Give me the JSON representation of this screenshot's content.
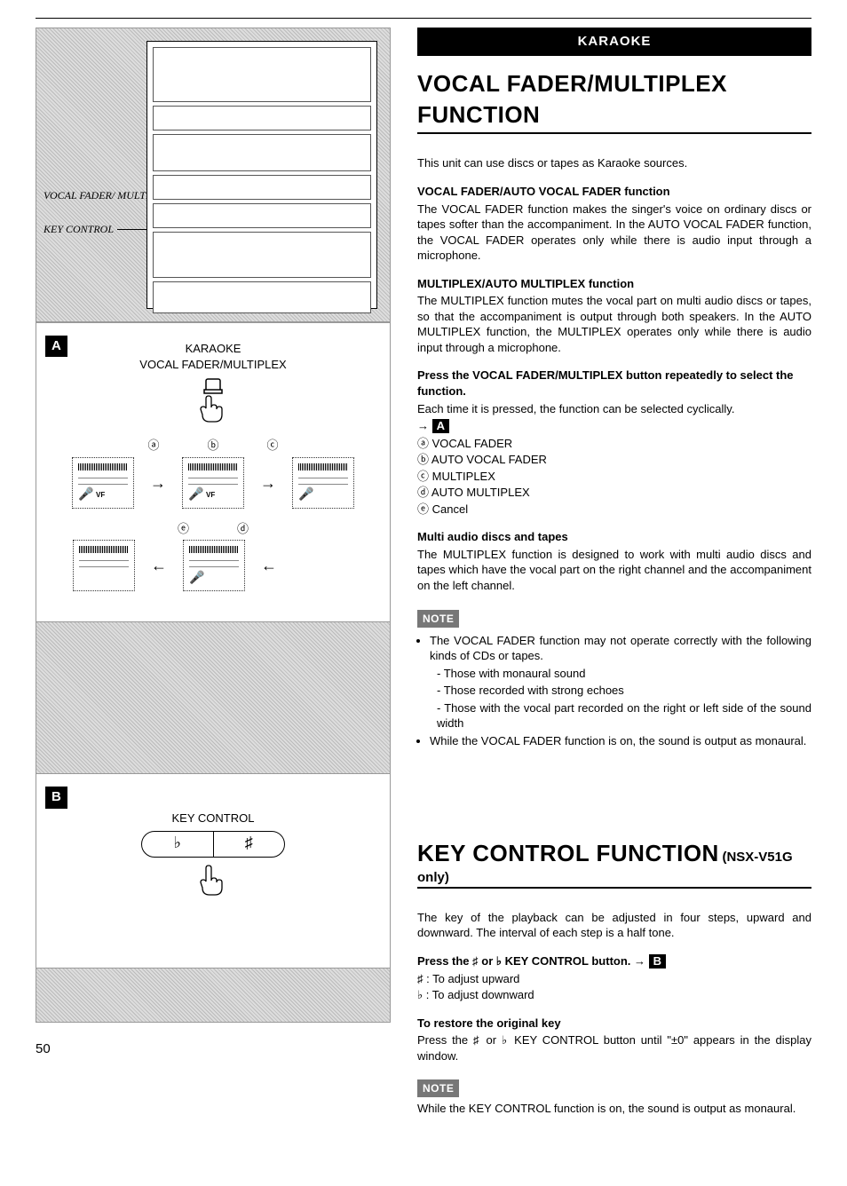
{
  "banner": "KARAOKE",
  "section1": {
    "title": "VOCAL FADER/MULTIPLEX FUNCTION",
    "intro": "This unit can use discs or tapes as Karaoke sources.",
    "sub1_h": "VOCAL FADER/AUTO VOCAL FADER function",
    "sub1_p": "The VOCAL FADER function makes the singer's voice on ordinary discs or tapes softer than the accompaniment. In the AUTO VOCAL FADER function, the VOCAL FADER operates only while there is audio input through a microphone.",
    "sub2_h": "MULTIPLEX/AUTO MULTIPLEX function",
    "sub2_p": "The MULTIPLEX function mutes the vocal part on multi audio discs or tapes, so that the accompaniment is output through both speakers. In the AUTO MULTIPLEX function, the MULTIPLEX operates only while there is audio input through a microphone.",
    "press_h": "Press the VOCAL FADER/MULTIPLEX button repeatedly to select the function.",
    "press_p": "Each time it is pressed, the function can be selected cyclically.",
    "ref_badge": "A",
    "options": {
      "a": "ⓐ VOCAL FADER",
      "b": "ⓑ AUTO VOCAL FADER",
      "c": "ⓒ MULTIPLEX",
      "d": "ⓓ AUTO MULTIPLEX",
      "e": "ⓔ Cancel"
    },
    "multi_h": "Multi audio discs and tapes",
    "multi_p": "The MULTIPLEX function is designed to work with multi audio discs and tapes which have the vocal part on the right channel and the accompaniment on the left channel.",
    "note_label": "NOTE",
    "note1": "The VOCAL FADER function may not operate correctly with the following kinds of CDs or tapes.",
    "note1_a": "Those with monaural sound",
    "note1_b": "Those recorded with strong echoes",
    "note1_c": "Those with the vocal part recorded on the right or left side of the sound width",
    "note2": "While the VOCAL FADER function is on, the sound is output as monaural."
  },
  "section2": {
    "title": "KEY CONTROL FUNCTION",
    "title_suffix": "(NSX-V51G only)",
    "intro": "The key of the playback can be adjusted in four steps, upward and downward. The interval of each step is a half tone.",
    "press_h": "Press the ♯ or ♭ KEY CONTROL button. →",
    "ref_badge": "B",
    "sharp": "♯ : To adjust upward",
    "flat": "♭ : To adjust downward",
    "restore_h": "To restore the original key",
    "restore_p": "Press the ♯ or ♭ KEY CONTROL button until \"±0\" appears in the display window.",
    "note_label": "NOTE",
    "note_p": "While the KEY CONTROL function is on, the sound is output as monaural."
  },
  "left": {
    "label_vf": "VOCAL FADER/ MULTIPLEX",
    "label_key": "KEY CONTROL",
    "panelA": {
      "badge": "A",
      "line1": "KARAOKE",
      "line2": "VOCAL FADER/MULTIPLEX",
      "labels": {
        "a": "ⓐ",
        "b": "ⓑ",
        "c": "ⓒ",
        "d": "ⓓ",
        "e": "ⓔ"
      }
    },
    "panelB": {
      "badge": "B",
      "title": "KEY CONTROL",
      "flat": "♭",
      "sharp": "♯"
    }
  },
  "page_number": "50"
}
